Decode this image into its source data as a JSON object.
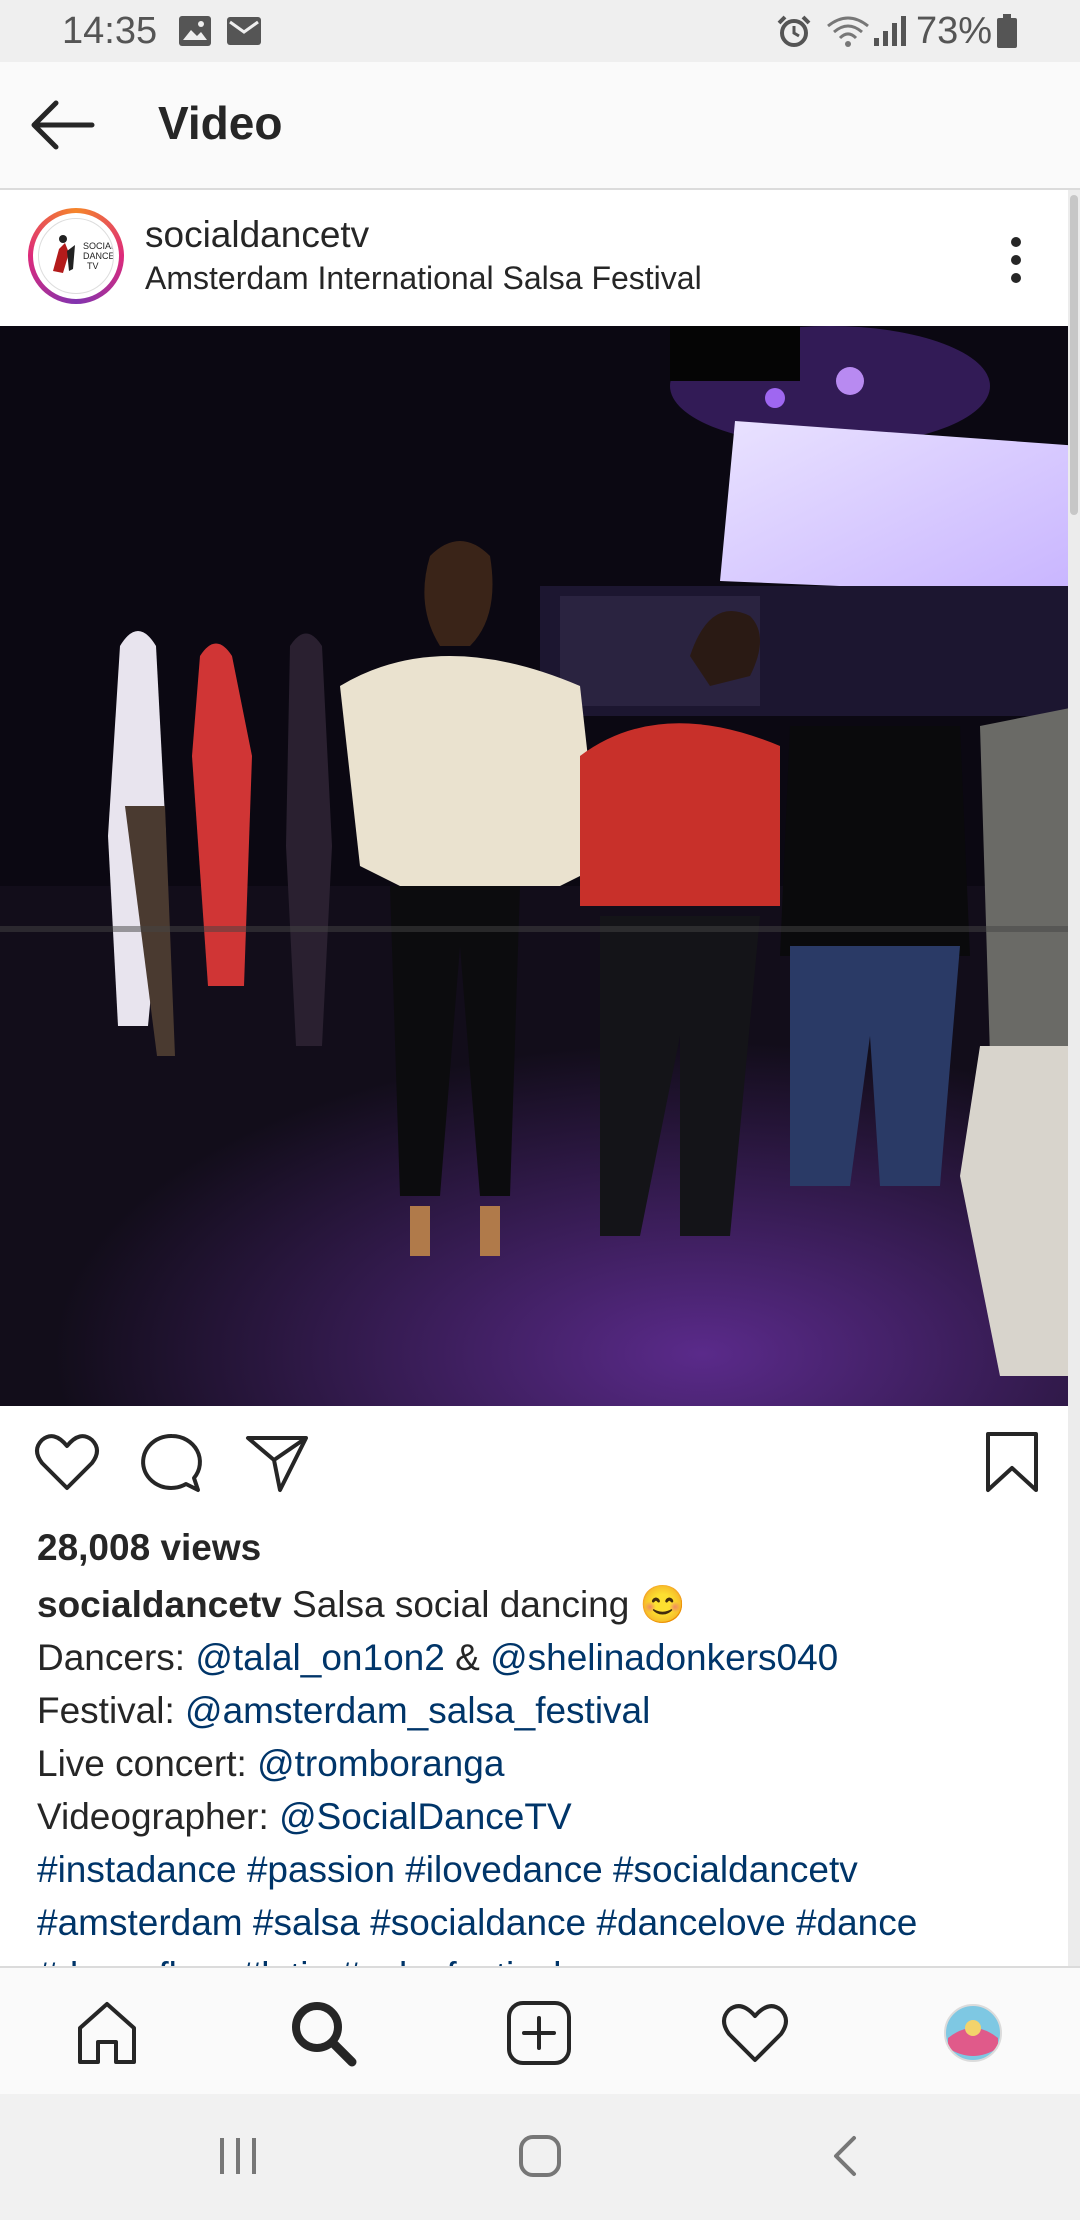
{
  "status_bar": {
    "time": "14:35",
    "left_icons": [
      "image-icon",
      "mail-icon"
    ],
    "right_icons": [
      "alarm-icon",
      "wifi-icon",
      "signal-icon",
      "battery-icon"
    ],
    "battery": "73%"
  },
  "topbar": {
    "back_icon": "arrow-left-icon",
    "title": "Video"
  },
  "post": {
    "username": "socialdancetv",
    "location": "Amsterdam International Salsa Festival",
    "avatar_logo_lines": [
      "SOCIAL",
      "DANCE",
      "TV"
    ],
    "more_icon": "more-vertical-icon"
  },
  "actions": {
    "icons": [
      "heart-icon",
      "comment-icon",
      "share-icon",
      "bookmark-icon"
    ]
  },
  "views": "28,008 views",
  "caption": {
    "username": "socialdancetv",
    "text": "Salsa social dancing",
    "emoji": "😊",
    "dancers_label": "Dancers:",
    "dancer1": "@talal_on1on2",
    "amp": "&",
    "dancer2": "@shelinadonkers040",
    "festival_label": "Festival:",
    "festival": "@amsterdam_salsa_festival",
    "concert_label": "Live concert:",
    "concert": "@tromboranga",
    "videographer_label": "Videographer:",
    "videographer": "@SocialDanceTV",
    "hashtags_line1": "#instadance #passion #ilovedance #socialdancetv",
    "hashtags_line2": "#amsterdam #salsa #socialdance #dancelove #dance",
    "hashtags_line3": "#dancefloor #latin #salsafestival"
  },
  "bottom_nav": {
    "items": [
      "home-icon",
      "search-icon",
      "add-post-icon",
      "activity-heart-icon",
      "profile-avatar"
    ],
    "active": "search-icon"
  },
  "system_nav": {
    "items": [
      "recents-icon",
      "home-button-icon",
      "back-chevron-icon"
    ]
  },
  "colors": {
    "link": "#003569",
    "text": "#262626",
    "divider": "#dbdbdb",
    "video_stage_light": "#9b4dff"
  }
}
